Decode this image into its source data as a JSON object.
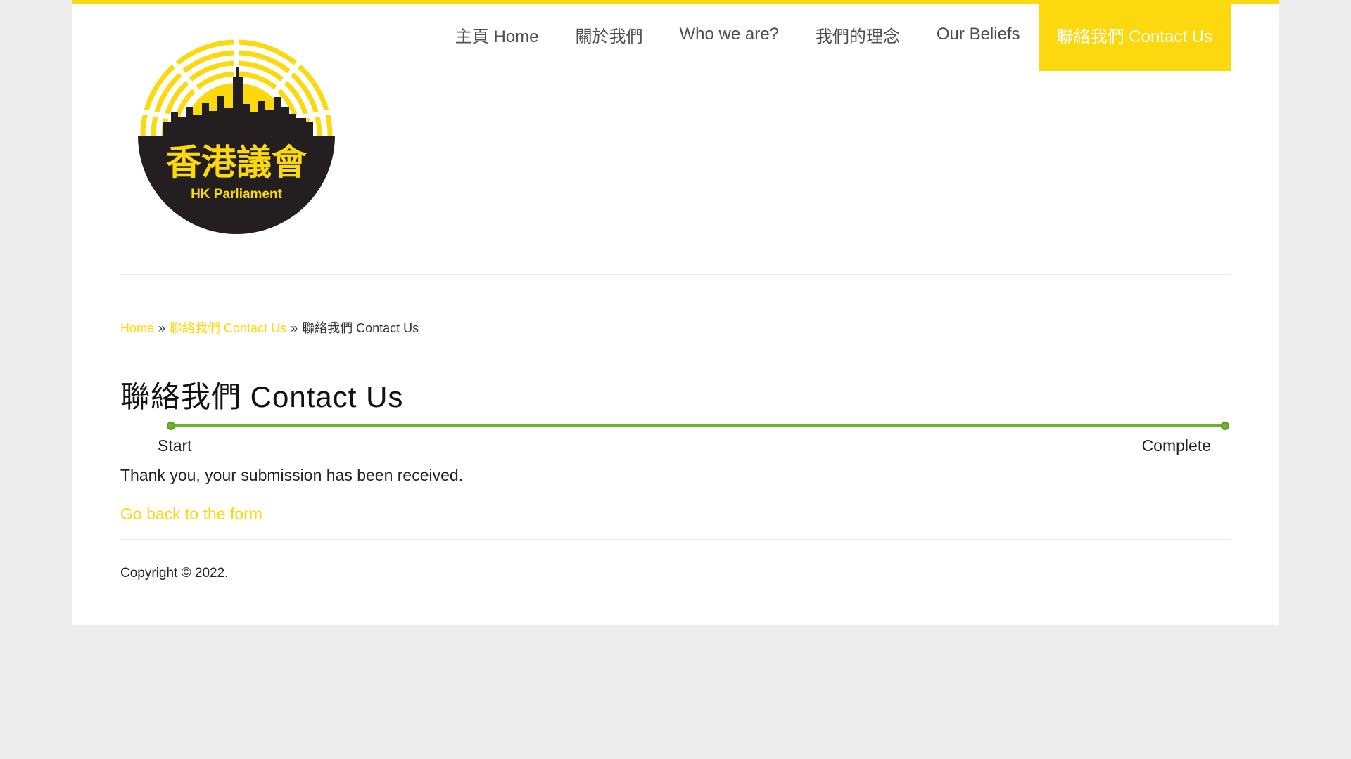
{
  "logo": {
    "title_text": "香港議會",
    "subtitle_text": "HK Parliament",
    "colors": {
      "yellow": "#fcd80f",
      "dark": "#231f20"
    }
  },
  "nav": {
    "items": [
      {
        "label": "主頁 Home",
        "active": false
      },
      {
        "label": "關於我們",
        "active": false
      },
      {
        "label": "Who we are?",
        "active": false
      },
      {
        "label": "我們的理念",
        "active": false
      },
      {
        "label": "Our Beliefs",
        "active": false
      },
      {
        "label": "聯絡我們 Contact Us",
        "active": true
      }
    ]
  },
  "breadcrumb": {
    "home": "Home",
    "separator": "»",
    "parent": "聯絡我們 Contact Us",
    "current": "聯絡我們 Contact Us"
  },
  "page": {
    "title": "聯絡我們 Contact Us"
  },
  "progress": {
    "value": 1.0,
    "start_label": "Start",
    "end_label": "Complete",
    "color": "#6fb52c"
  },
  "confirmation": {
    "message": "Thank you, your submission has been received.",
    "back_link": "Go back to the form"
  },
  "footer": {
    "copyright": "Copyright © 2022."
  },
  "colors": {
    "accent": "#fcd80f",
    "background": "#ededed",
    "content_bg": "#ffffff",
    "nav_text": "#4f4f4f",
    "body_text": "#222222"
  }
}
